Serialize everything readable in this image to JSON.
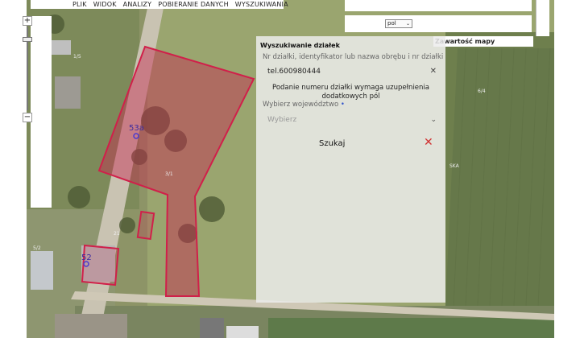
{
  "menu": {
    "items": [
      "PLIK",
      "WIDOK",
      "ANALIZY",
      "POBIERANIE DANYCH",
      "WYSZUKIWANIA"
    ]
  },
  "zoom": {
    "zoom_in": "+",
    "zoom_out": "−"
  },
  "language": {
    "value": "pol",
    "icon": "chevron-down-icon"
  },
  "map_content": {
    "label": "Zawartość mapy"
  },
  "search_panel": {
    "title": "Wyszukiwanie działek",
    "input_label": "Nr działki, identyfikator lub nazwa obrębu i nr działki",
    "input_value": "tel.600980444",
    "hint": "Podanie numeru działki wymaga uzupełnienia dodatkowych pól",
    "province_label": "Wybierz województwo",
    "province_required": "•",
    "province_placeholder": "Wybierz",
    "search_button": "Szukaj"
  },
  "map_labels": {
    "parcel_53a": "53a",
    "parcel_52": "52",
    "small": [
      "SKA",
      "1/5",
      "3/1",
      "6/4",
      "5/2",
      "21"
    ]
  },
  "colors": {
    "parcel_outline": "#d0204a",
    "required": "#3355cc"
  }
}
